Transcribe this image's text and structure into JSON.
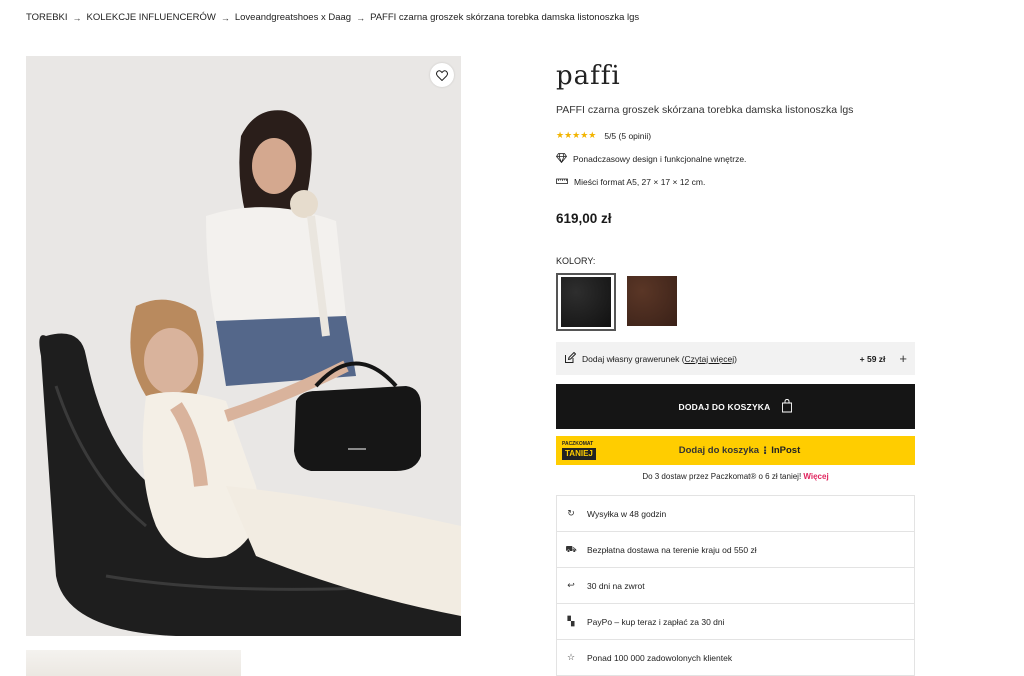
{
  "breadcrumb": {
    "items": [
      "TOREBKI",
      "KOLEKCJE INFLUENCERÓW",
      "Loveandgreatshoes x Daag",
      "PAFFI czarna groszek skórzana torebka damska listonoszka lgs"
    ],
    "separator": "→"
  },
  "product": {
    "brand": "paffi",
    "title": "PAFFI czarna groszek skórzana torebka damska listonoszka lgs",
    "stars": "★★★★★",
    "rating_text": "5/5 (5 opinii)",
    "features": [
      {
        "icon": "diamond-icon",
        "text": "Ponadczasowy design i funkcjonalne wnętrze."
      },
      {
        "icon": "ruler-icon",
        "text": "Mieści format A5, 27 × 17 × 12 cm."
      }
    ],
    "price": "619,00 zł"
  },
  "colors": {
    "label": "KOLORY:",
    "options": [
      {
        "name": "czarny",
        "hex": "#1c1c1c",
        "selected": true
      },
      {
        "name": "brązowy",
        "hex": "#4a2b1f",
        "selected": false
      }
    ]
  },
  "engrave": {
    "text_prefix": "Dodaj własny grawerunek (",
    "link": "Czytaj więcej",
    "text_suffix": ")",
    "price": "+ 59 zł",
    "plus": "+"
  },
  "cart": {
    "label": "DODAJ DO KOSZYKA"
  },
  "inpost": {
    "badge_small": "PACZKOMAT",
    "badge_big": "TANIEJ",
    "label": "Dodaj do koszyka",
    "logo": "InPost"
  },
  "delivery_note": {
    "text": "Do 3 dostaw przez Paczkomat® o 6 zł taniej!",
    "link": "Więcej"
  },
  "benefits": [
    {
      "icon": "clock-history-icon",
      "glyph": "↻",
      "text": "Wysyłka w 48 godzin"
    },
    {
      "icon": "truck-icon",
      "glyph": "⛟",
      "text": "Bezpłatna dostawa na terenie kraju od 550 zł"
    },
    {
      "icon": "return-icon",
      "glyph": "↩",
      "text": "30 dni na zwrot"
    },
    {
      "icon": "paypo-icon",
      "glyph": "▚",
      "text": "PayPo – kup teraz i zapłać za 30 dni"
    },
    {
      "icon": "star-outline-icon",
      "glyph": "☆",
      "text": "Ponad 100 000 zadowolonych klientek"
    }
  ],
  "colors_theme": {
    "accent_pink": "#e0245e",
    "inpost_yellow": "#ffcd00",
    "cart_black": "#151515",
    "star_gold": "#f2b400"
  }
}
